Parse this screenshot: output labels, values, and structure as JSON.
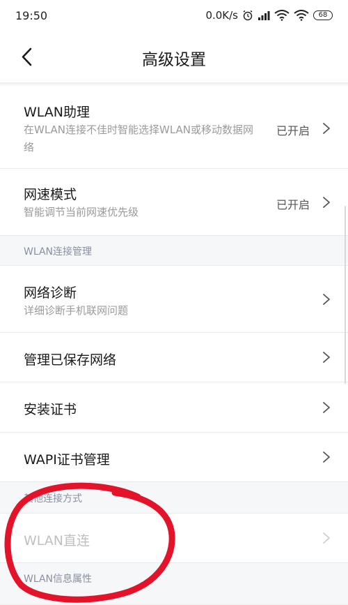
{
  "status_bar": {
    "time": "19:50",
    "speed": "0.0K/s",
    "battery": "68",
    "icons": [
      "alarm-icon",
      "signal-icon",
      "wifi-icon",
      "hotspot-wifi-icon",
      "battery-icon"
    ]
  },
  "header": {
    "title": "高级设置",
    "back_icon": "chevron-left-icon"
  },
  "items": {
    "wlan_assistant": {
      "title": "WLAN助理",
      "subtitle": "在WLAN连接不佳时智能选择WLAN或移动数据网络",
      "value": "已开启"
    },
    "speed_mode": {
      "title": "网速模式",
      "subtitle": "智能调节当前网速优先级",
      "value": "已开启"
    },
    "network_diagnosis": {
      "title": "网络诊断",
      "subtitle": "详细诊断手机联网问题"
    },
    "saved_networks": {
      "title": "管理已保存网络"
    },
    "install_cert": {
      "title": "安装证书"
    },
    "wapi_cert": {
      "title": "WAPI证书管理"
    },
    "wlan_direct": {
      "title": "WLAN直连"
    }
  },
  "sections": {
    "connection_mgmt": "WLAN连接管理",
    "other_methods": "其他连接方式",
    "info_props": "WLAN信息属性"
  },
  "colors": {
    "annotation_circle": "#e3142a",
    "section_bg": "#f6f7f9",
    "section_text": "#8a8fa2",
    "disabled_text": "#bfbfbf"
  }
}
